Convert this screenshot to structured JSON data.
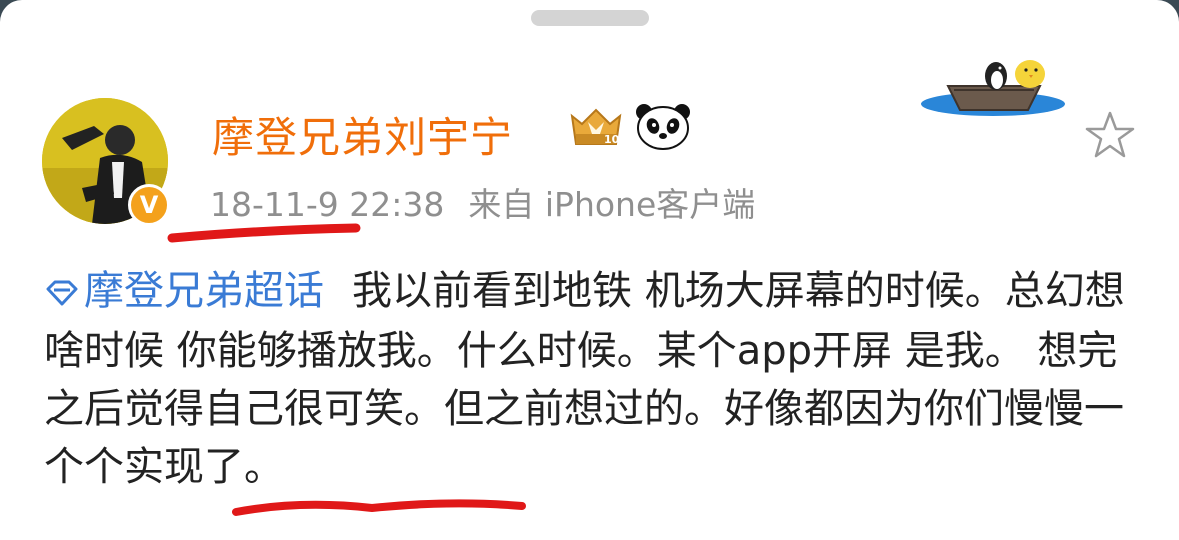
{
  "user": {
    "name": "摩登兄弟刘宇宁",
    "badge_text": "10",
    "verified_mark": "V"
  },
  "meta": {
    "date": "18-11-9 22:38",
    "source": "来自 iPhone客户端"
  },
  "post": {
    "topic": "摩登兄弟超话",
    "text": "我以前看到地铁 机场大屏幕的时候。总幻想啥时候 你能够播放我。什么时候。某个app开屏 是我。 想完之后觉得自己很可笑。但之前想过的。好像都因为你们慢慢一个个实现了。"
  },
  "icons": [
    "crown-level-icon",
    "panda-emoji-icon",
    "penguin-boat-sticker",
    "star-favorite-icon",
    "supertopic-diamond-icon"
  ],
  "colors": {
    "username": "#f06e0a",
    "topic": "#3a7bd5",
    "meta": "#8f8f8f",
    "annotation": "#e01818"
  }
}
